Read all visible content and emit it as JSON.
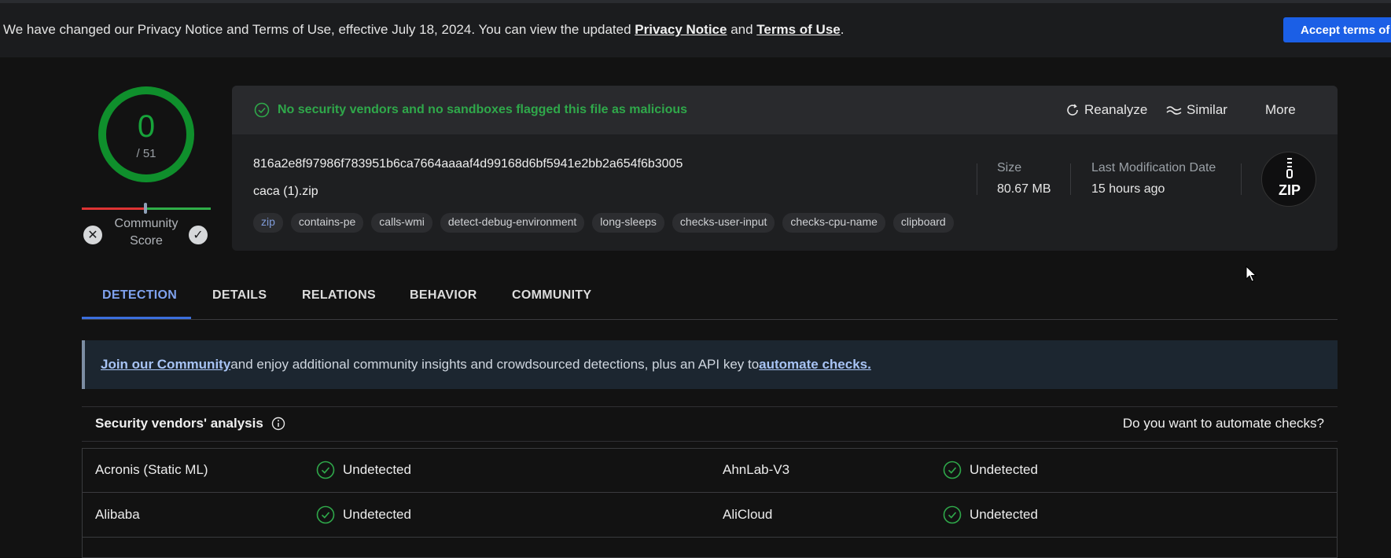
{
  "banner": {
    "text_before": "We have changed our Privacy Notice and Terms of Use, effective July 18, 2024. You can view the updated ",
    "privacy_link": "Privacy Notice",
    "and": " and ",
    "terms_link": "Terms of Use",
    "period": ".",
    "accept_button": "Accept terms of us"
  },
  "score": {
    "detections": "0",
    "total": "/ 51",
    "community_label": "Community Score",
    "ring_color": "#0f8f2c"
  },
  "summary": {
    "status": "No security vendors and no sandboxes flagged this file as malicious",
    "actions": {
      "reanalyze": "Reanalyze",
      "similar": "Similar",
      "more": "More"
    },
    "hash": "816a2e8f97986f783951b6ca7664aaaaf4d99168d6bf5941e2bb2a654f6b3005",
    "filename": "caca (1).zip",
    "tags": [
      "zip",
      "contains-pe",
      "calls-wmi",
      "detect-debug-environment",
      "long-sleeps",
      "checks-user-input",
      "checks-cpu-name",
      "clipboard"
    ],
    "size_label": "Size",
    "size_value": "80.67 MB",
    "modified_label": "Last Modification Date",
    "modified_value": "15 hours ago",
    "file_type": "ZIP"
  },
  "tabs": [
    "DETECTION",
    "DETAILS",
    "RELATIONS",
    "BEHAVIOR",
    "COMMUNITY"
  ],
  "notice": {
    "join_link": "Join our Community",
    "middle": " and enjoy additional community insights and crowdsourced detections, plus an API key to ",
    "automate_link": "automate checks."
  },
  "vendors": {
    "title": "Security vendors' analysis",
    "automate": "Do you want to automate checks?",
    "rows": [
      {
        "left_name": "Acronis (Static ML)",
        "left_result": "Undetected",
        "right_name": "AhnLab-V3",
        "right_result": "Undetected"
      },
      {
        "left_name": "Alibaba",
        "left_result": "Undetected",
        "right_name": "AliCloud",
        "right_result": "Undetected"
      }
    ]
  }
}
